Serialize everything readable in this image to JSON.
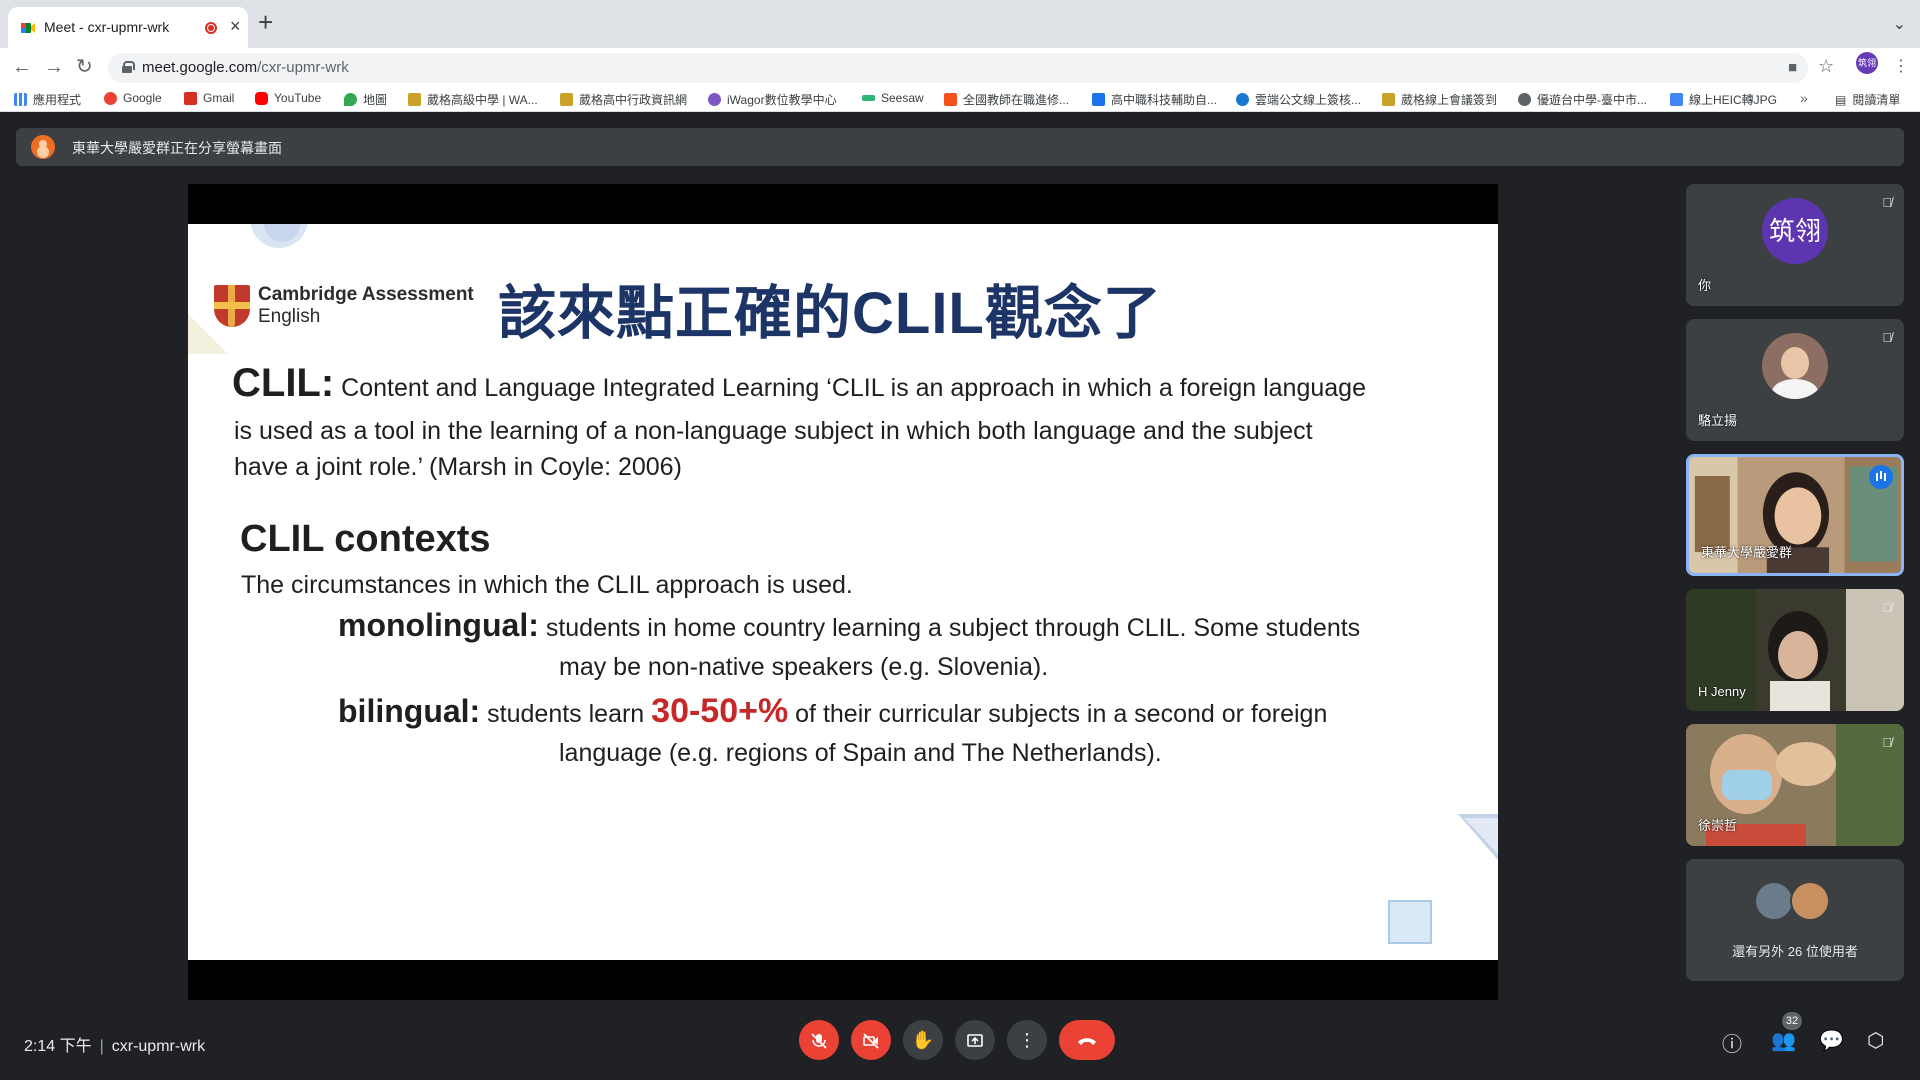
{
  "browser": {
    "tab_title": "Meet - cxr-upmr-wrk",
    "url_host": "meet.google.com",
    "url_path": "/cxr-upmr-wrk",
    "profile_initials": "筑翎"
  },
  "bookmarks": [
    {
      "label": "應用程式",
      "color": "#4285f4"
    },
    {
      "label": "Google",
      "color": "#ea4335"
    },
    {
      "label": "Gmail",
      "color": "#d93025"
    },
    {
      "label": "YouTube",
      "color": "#ff0000"
    },
    {
      "label": "地圖",
      "color": "#34a853"
    },
    {
      "label": "葳格高級中學 | WA...",
      "color": "#c9a227"
    },
    {
      "label": "葳格高中行政資訊網",
      "color": "#c9a227"
    },
    {
      "label": "iWagor數位教學中心",
      "color": "#7e57c2"
    },
    {
      "label": "Seesaw",
      "color": "#2bb673"
    },
    {
      "label": "全國教師在職進修...",
      "color": "#f4511e"
    },
    {
      "label": "高中職科技輔助自...",
      "color": "#1a73e8"
    },
    {
      "label": "雲端公文線上簽核...",
      "color": "#1976d2"
    },
    {
      "label": "葳格線上會議簽到",
      "color": "#c9a227"
    },
    {
      "label": "優遊台中學-臺中市...",
      "color": "#5f6368"
    },
    {
      "label": "線上HEIC轉JPG",
      "color": "#4285f4"
    }
  ],
  "reading_list": "閱讀清單",
  "meet": {
    "present_banner": "東華大學嚴愛群正在分享螢幕畫面",
    "time": "2:14 下午",
    "meeting_code": "cxr-upmr-wrk",
    "participant_count": "32"
  },
  "slide": {
    "logo_line1": "Cambridge Assessment",
    "logo_line2": "English",
    "title": "該來點正確的CLIL觀念了",
    "clil_label": "CLIL:",
    "clil_def_1": "Content and Language Integrated Learning ‘CLIL is an approach in which a foreign language",
    "clil_def_2": "is used as a tool in the learning of a non-language subject in which both language and the subject",
    "clil_def_3": "have a joint role.’ (Marsh in Coyle: 2006)",
    "contexts_heading": "CLIL contexts",
    "contexts_desc": "The circumstances in which the CLIL approach is used.",
    "mono_label": "monolingual:",
    "mono_text_1": "students in home country learning a subject through CLIL. Some students",
    "mono_text_2": "may be non-native speakers (e.g. Slovenia).",
    "bi_label": "bilingual:",
    "bi_pre": "students learn",
    "bi_highlight": "30-50+%",
    "bi_post": "of their curricular subjects in a second or foreign",
    "bi_text_2": "language (e.g. regions of Spain and The Netherlands)."
  },
  "participants": [
    {
      "name": "你",
      "avatar_text": "筑翎"
    },
    {
      "name": "駱立揚"
    },
    {
      "name": "東華大學嚴愛群"
    },
    {
      "name": "H Jenny"
    },
    {
      "name": "徐崇哲"
    }
  ],
  "others_label": "還有另外 26 位使用者"
}
